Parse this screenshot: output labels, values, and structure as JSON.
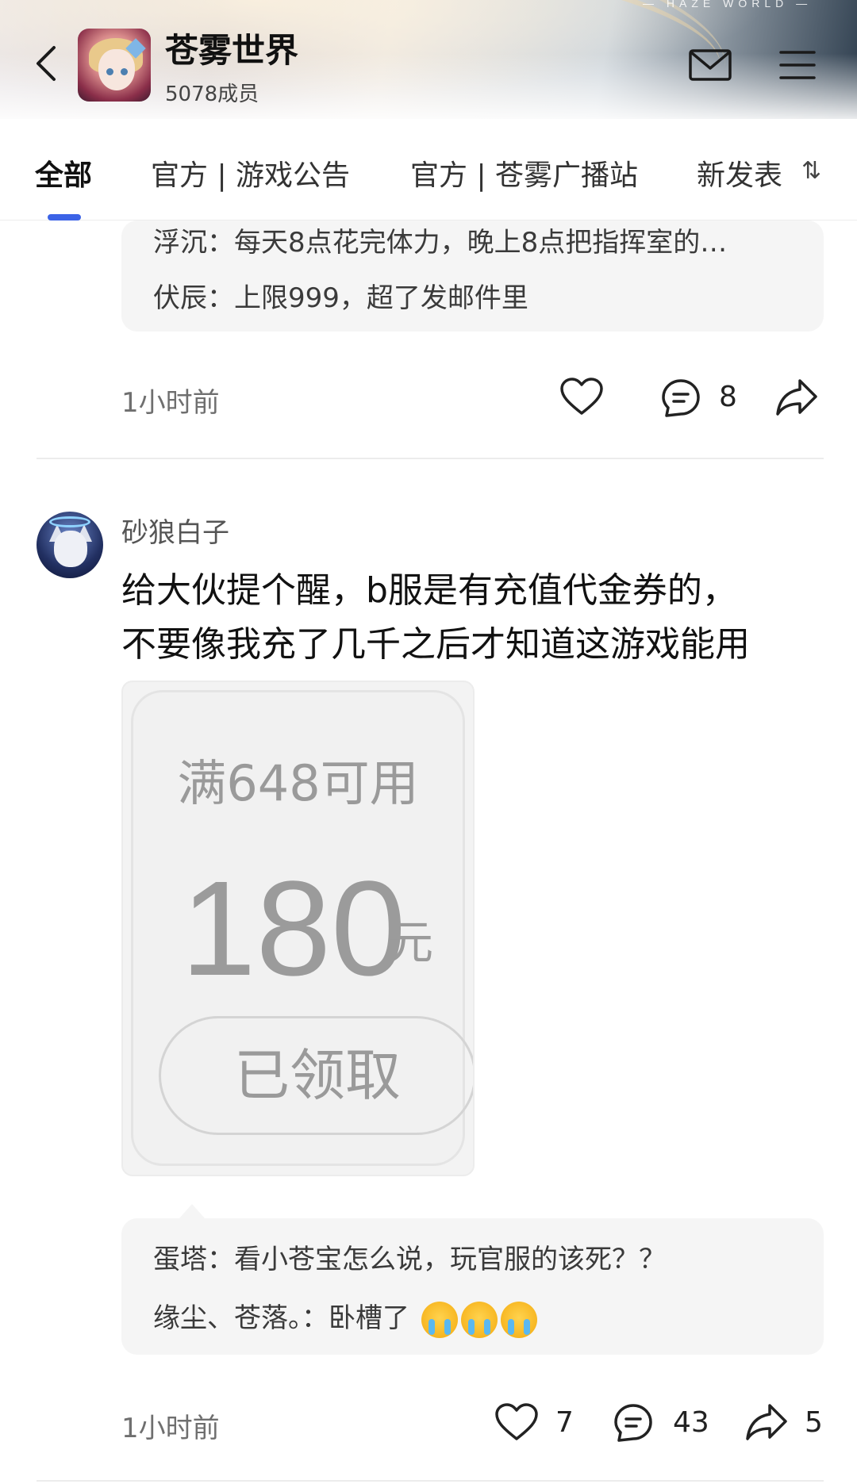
{
  "header": {
    "banner_tag": "— HAZE WORLD —",
    "title": "苍雾世界",
    "members": "5078成员"
  },
  "tabs": [
    {
      "label": "全部",
      "active": true
    },
    {
      "label": "官方 | 游戏公告",
      "active": false
    },
    {
      "label": "官方 | 苍雾广播站",
      "active": false
    },
    {
      "label": "新发表",
      "active": false
    }
  ],
  "sort_icon": "⇅",
  "post1": {
    "comments": [
      {
        "author": "浮沉",
        "text": "每天8点花完体力，晚上8点把指挥室的…"
      },
      {
        "author": "伏辰",
        "text": "上限999，超了发邮件里"
      }
    ],
    "time": "1小时前",
    "likes": "",
    "comment_count": "8",
    "shares": ""
  },
  "post2": {
    "author": "砂狼白子",
    "text_line1": "给大伙提个醒，b服是有充值代金券的，",
    "text_line2": "不要像我充了几千之后才知道这游戏能用",
    "coupon": {
      "condition": "满648可用",
      "amount": "180",
      "unit": "元",
      "button": "已领取"
    },
    "comments": [
      {
        "author": "蛋塔",
        "text": "看小苍宝怎么说，玩官服的该死？？"
      },
      {
        "author": "缘尘、苍落。",
        "text": "卧槽了"
      }
    ],
    "time": "1小时前",
    "likes": "7",
    "comment_count": "43",
    "shares": "5"
  },
  "colors": {
    "accent": "#3c63e6",
    "comment_bg": "#f5f5f5",
    "emoji": "#f6b21b"
  }
}
